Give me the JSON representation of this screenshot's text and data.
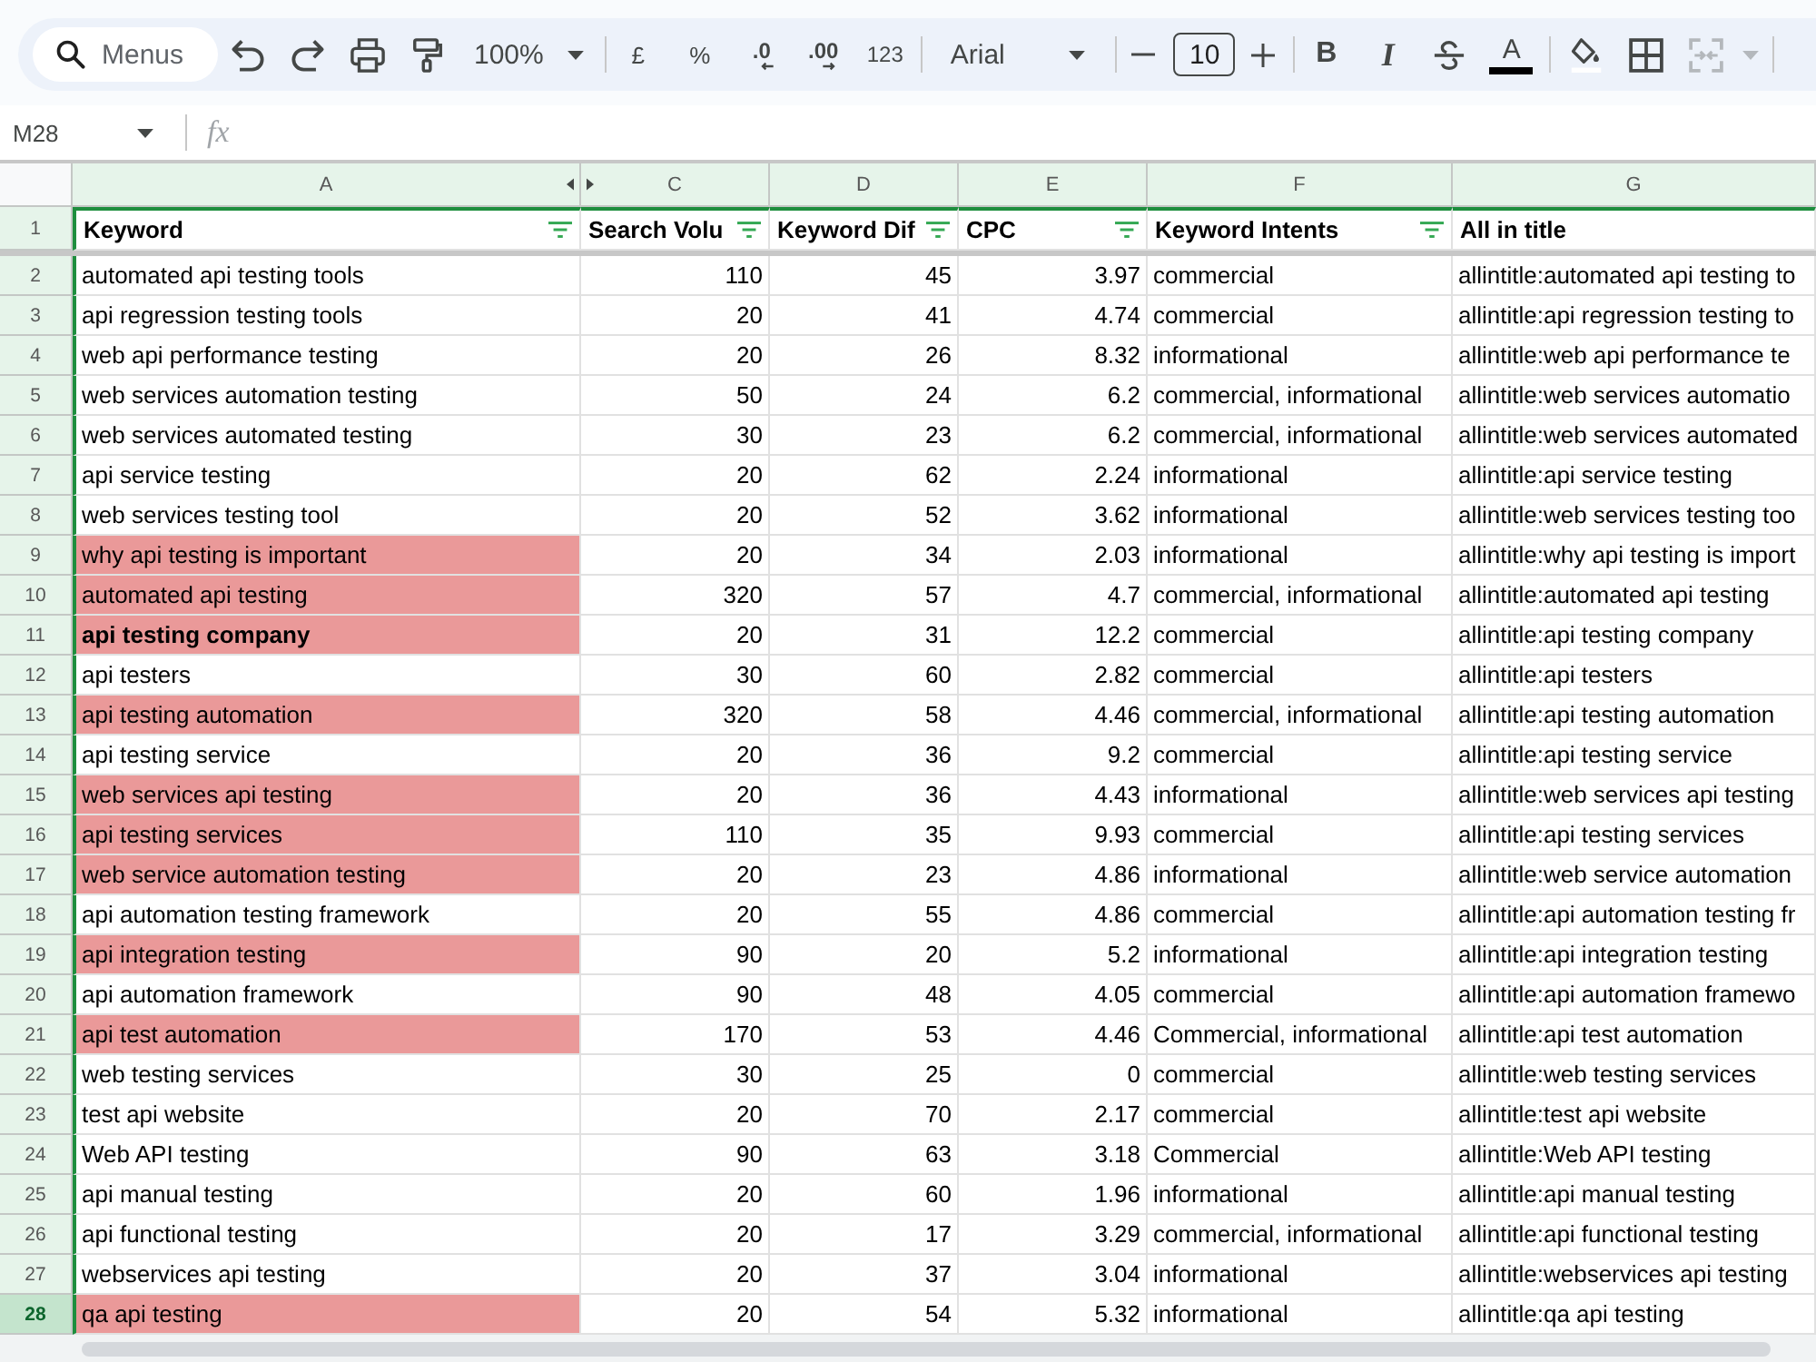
{
  "toolbar": {
    "search": {
      "placeholder": "Menus"
    },
    "zoom": "100%",
    "number_formats": [
      {
        "kind": "currency",
        "label": "£"
      },
      {
        "kind": "percent",
        "label": "%"
      },
      {
        "kind": "decrease_decimals",
        "label": ".0"
      },
      {
        "kind": "increase_decimals",
        "label": ".00"
      },
      {
        "kind": "more_formats",
        "label": "123"
      }
    ],
    "font": "Arial",
    "font_size": {
      "value": "10"
    },
    "text_formats": [
      {
        "kind": "bold",
        "label": "B"
      },
      {
        "kind": "italic",
        "label": "I"
      },
      {
        "kind": "strikethrough"
      },
      {
        "kind": "text_color",
        "label": "A"
      }
    ],
    "merge": {
      "disabled": true
    }
  },
  "formula_bar": {
    "cell": "M28",
    "fx_label": "fx"
  },
  "columns": [
    {
      "letter": "A",
      "hidden_after": true
    },
    {
      "letter": "C",
      "hidden_after": false
    },
    {
      "letter": "D",
      "hidden_after": false
    },
    {
      "letter": "E",
      "hidden_after": false
    },
    {
      "letter": "F",
      "hidden_after": false
    },
    {
      "letter": "G",
      "hidden_after": false
    }
  ],
  "header_row": {
    "number": "1",
    "cells": [
      {
        "text": "Keyword",
        "filter": true
      },
      {
        "text": "Search Volu",
        "filter": true
      },
      {
        "text": "Keyword Dif",
        "filter": true
      },
      {
        "text": "CPC",
        "filter": true
      },
      {
        "text": "Keyword Intents",
        "filter": true
      },
      {
        "text": "All in title",
        "filter": false
      }
    ]
  },
  "rows": [
    {
      "number": "2",
      "cells": [
        "automated api testing tools",
        "110",
        "45",
        "3.97",
        "commercial",
        "allintitle:automated api testing to"
      ],
      "highlighted": false,
      "bold": false,
      "selected": false
    },
    {
      "number": "3",
      "cells": [
        "api regression testing tools",
        "20",
        "41",
        "4.74",
        "commercial",
        "allintitle:api regression testing to"
      ],
      "highlighted": false,
      "bold": false,
      "selected": false
    },
    {
      "number": "4",
      "cells": [
        "web api performance testing",
        "20",
        "26",
        "8.32",
        "informational",
        "allintitle:web api performance te"
      ],
      "highlighted": false,
      "bold": false,
      "selected": false
    },
    {
      "number": "5",
      "cells": [
        "web services automation testing",
        "50",
        "24",
        "6.2",
        "commercial, informational",
        "allintitle:web services automatio"
      ],
      "highlighted": false,
      "bold": false,
      "selected": false
    },
    {
      "number": "6",
      "cells": [
        "web services automated testing",
        "30",
        "23",
        "6.2",
        "commercial, informational",
        "allintitle:web services automated"
      ],
      "highlighted": false,
      "bold": false,
      "selected": false
    },
    {
      "number": "7",
      "cells": [
        "api service testing",
        "20",
        "62",
        "2.24",
        "informational",
        "allintitle:api service testing"
      ],
      "highlighted": false,
      "bold": false,
      "selected": false
    },
    {
      "number": "8",
      "cells": [
        "web services testing tool",
        "20",
        "52",
        "3.62",
        "informational",
        "allintitle:web services testing too"
      ],
      "highlighted": false,
      "bold": false,
      "selected": false
    },
    {
      "number": "9",
      "cells": [
        "why api testing is important",
        "20",
        "34",
        "2.03",
        "informational",
        "allintitle:why api testing is import"
      ],
      "highlighted": true,
      "bold": false,
      "selected": false
    },
    {
      "number": "10",
      "cells": [
        "automated api testing",
        "320",
        "57",
        "4.7",
        "commercial, informational",
        "allintitle:automated api testing"
      ],
      "highlighted": true,
      "bold": false,
      "selected": false
    },
    {
      "number": "11",
      "cells": [
        "api testing company",
        "20",
        "31",
        "12.2",
        "commercial",
        "allintitle:api testing company"
      ],
      "highlighted": true,
      "bold": true,
      "selected": false
    },
    {
      "number": "12",
      "cells": [
        "api testers",
        "30",
        "60",
        "2.82",
        "commercial",
        "allintitle:api testers"
      ],
      "highlighted": false,
      "bold": false,
      "selected": false
    },
    {
      "number": "13",
      "cells": [
        "api testing automation",
        "320",
        "58",
        "4.46",
        "commercial, informational",
        "allintitle:api testing automation"
      ],
      "highlighted": true,
      "bold": false,
      "selected": false
    },
    {
      "number": "14",
      "cells": [
        "api testing service",
        "20",
        "36",
        "9.2",
        "commercial",
        "allintitle:api testing service"
      ],
      "highlighted": false,
      "bold": false,
      "selected": false
    },
    {
      "number": "15",
      "cells": [
        "web services api testing",
        "20",
        "36",
        "4.43",
        "informational",
        "allintitle:web services api testing"
      ],
      "highlighted": true,
      "bold": false,
      "selected": false
    },
    {
      "number": "16",
      "cells": [
        "api testing services",
        "110",
        "35",
        "9.93",
        "commercial",
        "allintitle:api testing services"
      ],
      "highlighted": true,
      "bold": false,
      "selected": false
    },
    {
      "number": "17",
      "cells": [
        "web service automation testing",
        "20",
        "23",
        "4.86",
        "informational",
        "allintitle:web service automation"
      ],
      "highlighted": true,
      "bold": false,
      "selected": false
    },
    {
      "number": "18",
      "cells": [
        "api automation testing framework",
        "20",
        "55",
        "4.86",
        "commercial",
        "allintitle:api automation testing fr"
      ],
      "highlighted": false,
      "bold": false,
      "selected": false
    },
    {
      "number": "19",
      "cells": [
        "api integration testing",
        "90",
        "20",
        "5.2",
        "informational",
        "allintitle:api integration testing"
      ],
      "highlighted": true,
      "bold": false,
      "selected": false
    },
    {
      "number": "20",
      "cells": [
        "api automation framework",
        "90",
        "48",
        "4.05",
        "commercial",
        "allintitle:api automation framewo"
      ],
      "highlighted": false,
      "bold": false,
      "selected": false
    },
    {
      "number": "21",
      "cells": [
        "api test automation",
        "170",
        "53",
        "4.46",
        "Commercial, informational",
        "allintitle:api test automation"
      ],
      "highlighted": true,
      "bold": false,
      "selected": false
    },
    {
      "number": "22",
      "cells": [
        "web testing services",
        "30",
        "25",
        "0",
        "commercial",
        "allintitle:web testing services"
      ],
      "highlighted": false,
      "bold": false,
      "selected": false
    },
    {
      "number": "23",
      "cells": [
        "test api website",
        "20",
        "70",
        "2.17",
        "commercial",
        "allintitle:test api website"
      ],
      "highlighted": false,
      "bold": false,
      "selected": false
    },
    {
      "number": "24",
      "cells": [
        "Web API testing",
        "90",
        "63",
        "3.18",
        "Commercial",
        "allintitle:Web API testing"
      ],
      "highlighted": false,
      "bold": false,
      "selected": false
    },
    {
      "number": "25",
      "cells": [
        "api manual testing",
        "20",
        "60",
        "1.96",
        "informational",
        "allintitle:api manual testing"
      ],
      "highlighted": false,
      "bold": false,
      "selected": false
    },
    {
      "number": "26",
      "cells": [
        "api functional testing",
        "20",
        "17",
        "3.29",
        "commercial, informational",
        "allintitle:api functional testing"
      ],
      "highlighted": false,
      "bold": false,
      "selected": false
    },
    {
      "number": "27",
      "cells": [
        "webservices api testing",
        "20",
        "37",
        "3.04",
        "informational",
        "allintitle:webservices api testing"
      ],
      "highlighted": false,
      "bold": false,
      "selected": false
    },
    {
      "number": "28",
      "cells": [
        "qa api testing",
        "20",
        "54",
        "5.32",
        "informational",
        "allintitle:qa api testing"
      ],
      "highlighted": true,
      "bold": false,
      "selected": true
    }
  ]
}
